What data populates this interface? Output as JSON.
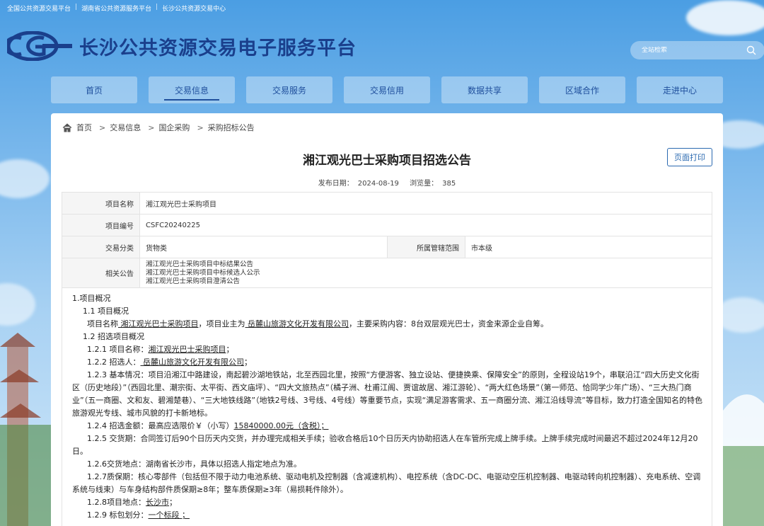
{
  "top_links": [
    "全国公共资源交易平台",
    "湖南省公共资源服务平台",
    "长沙公共资源交易中心"
  ],
  "site_title": "长沙公共资源交易电子服务平台",
  "search": {
    "placeholder": "全站检索"
  },
  "nav": [
    "首页",
    "交易信息",
    "交易服务",
    "交易信用",
    "数据共享",
    "区域合作",
    "走进中心"
  ],
  "breadcrumb": [
    "首页",
    "交易信息",
    "国企采购",
    "采购招标公告"
  ],
  "page": {
    "title": "湘江观光巴士采购项目招选公告",
    "print_label": "页面打印",
    "publish_label": "发布日期：",
    "publish_date": "2024-08-19",
    "views_label": "浏览量：",
    "views": "385"
  },
  "info": {
    "project_name_label": "项目名称",
    "project_name": "湘江观光巴士采购项目",
    "project_no_label": "项目编号",
    "project_no": "CSFC20240225",
    "category_label": "交易分类",
    "category": "货物类",
    "scope_label": "所属管辖范围",
    "scope": "市本级",
    "related_label": "相关公告",
    "related": [
      "湘江观光巴士采购项目中标结果公告",
      "湘江观光巴士采购项目中标候选人公示",
      "湘江观光巴士采购项目澄清公告"
    ]
  },
  "content": {
    "h1": "1.项目概况",
    "h1_1": "1.1 项目概况",
    "p1a": "项目名称",
    "p1b": " 湘江观光巴士采购项目",
    "p1c": "，项目业主为",
    "p1d": " 岳麓山旅游文化开发有限公司",
    "p1e": "，主要采购内容：8台双层观光巴士，资金来源企业自筹。",
    "h1_2": "1.2 招选项目概况",
    "p121a": "1.2.1  项目名称：",
    "p121b": "湘江观光巴士采购项目",
    "p121c": "；",
    "p122a": "1.2.2  招选人：",
    "p122b": " 岳麓山旅游文化开发有限公司",
    "p122c": "；",
    "p123": "1.2.3  基本情况：项目沿湘江中路建设，南起碧沙湖地铁站，北至西园北里，按照“方便游客、独立设站、便捷换乘、保障安全”的原则，全程设站19个，串联沿江“四大历史文化街区（历史地段）”（西园北里、潮宗街、太平街、西文庙坪）、“四大文旅热点”（橘子洲、杜甫江阁、贾谊故居、湘江游轮）、“两大红色场景”（第一师范、恰同学少年广场）、“三大热门商业”（五一商圈、文和友、碧湘楚巷）、“三大地铁线路”（地铁2号线、3号线、4号线）等重要节点，实现“满足游客需求、五一商圈分流、湘江沿线导流”等目标，致力打造全国知名的特色旅游观光专线、城市风貌的打卡新地标。",
    "p124a": "1.2.4 招选金额：最高应选限价￥（小写）",
    "p124b": "15840000.00元（含税）；",
    "p125": "1.2.5 交货期：合同签订后90个日历天内交货，并办理完成相关手续；验收合格后10个日历天内协助招选人在车管所完成上牌手续。上牌手续完成时间最迟不超过2024年12月20日。",
    "p126": "1.2.6交货地点：湖南省长沙市，具体以招选人指定地点为准。",
    "p127": "1.2.7质保期：核心零部件（包括但不限于动力电池系统、驱动电机及控制器（含减速机构）、电控系统（含DC-DC、电驱动空压机控制器、电驱动转向机控制器）、充电系统、空调系统与线束）与车身结构部件质保期≥8年；整车质保期≥3年（易损耗件除外）。",
    "p128a": "1.2.8项目地点：",
    "p128b": "长沙市",
    "p128c": "；",
    "p129a": "1.2.9 标包划分：",
    "p129b": "一个标段 ；"
  },
  "colors": {
    "brand": "#1a3f8c",
    "nav_text": "#1f4f9c",
    "print_border": "#2a69b0"
  }
}
